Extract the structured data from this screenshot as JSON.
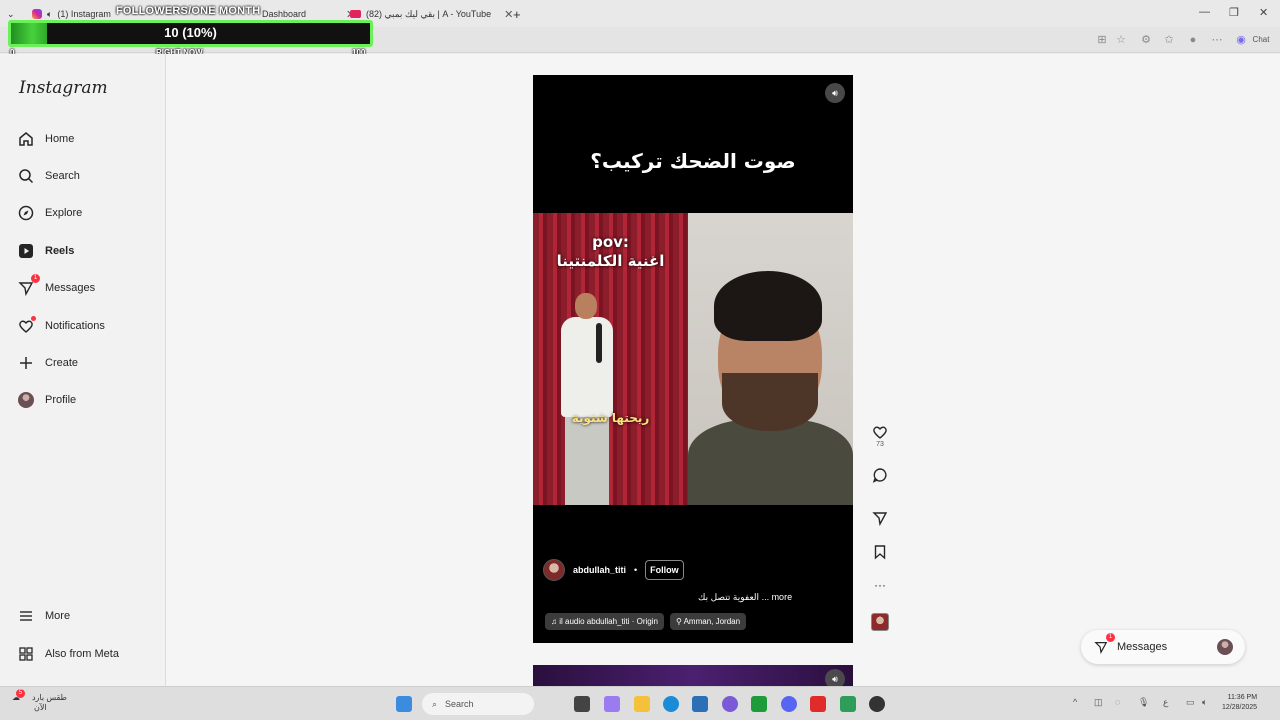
{
  "browser": {
    "tabs": [
      {
        "title": "(1) Instagram"
      },
      {
        "title": "Dashboard"
      },
      {
        "title": "(82) بقي ليك بمبي | A - YouTube"
      }
    ],
    "new_tab": "+",
    "chat_label": "Chat"
  },
  "overlay": {
    "title": "FOLLOWERS/ONE MONTH",
    "progress_text": "10 (10%)",
    "progress_fraction": 0.1,
    "min_label": "0",
    "mid_label": "RIGHT NOW",
    "max_label": "100"
  },
  "sidebar": {
    "logo": "Instagram",
    "items": [
      {
        "label": "Home",
        "icon": "home-icon"
      },
      {
        "label": "Search",
        "icon": "search-icon"
      },
      {
        "label": "Explore",
        "icon": "compass-icon"
      },
      {
        "label": "Reels",
        "icon": "reels-icon"
      },
      {
        "label": "Messages",
        "icon": "messenger-icon",
        "badge": "1"
      },
      {
        "label": "Notifications",
        "icon": "heart-icon"
      },
      {
        "label": "Create",
        "icon": "plus-icon"
      },
      {
        "label": "Profile",
        "icon": "avatar"
      }
    ],
    "more": "More",
    "also_from_meta": "Also from Meta"
  },
  "reel": {
    "top_caption": "صوت الضحك تركيب؟",
    "pov_line1": "pov:",
    "pov_line2": "اغنية الكلمنتينا",
    "subtitle": "ريحتها شتوية",
    "author": "abdullah_titi",
    "separator": "•",
    "follow_label": "Follow",
    "description": "العفوية تتصل بك ... more",
    "audio": "♫ il audio   abdullah_titi · Origin",
    "location": "Amman, Jordan",
    "like_count": "73"
  },
  "messages_pill": {
    "label": "Messages",
    "badge": "1"
  },
  "taskbar": {
    "weather_line1": "طقس بارد",
    "weather_line2": "الآن",
    "weather_badge": "5",
    "search_placeholder": "Search",
    "time": "11:36 PM",
    "date": "12/28/2025",
    "lang": "ع"
  },
  "colors": {
    "progress_green": "#49d13c",
    "progress_border": "#6cf05a",
    "badge_red": "#ff3040",
    "reel_bg": "#000000"
  }
}
